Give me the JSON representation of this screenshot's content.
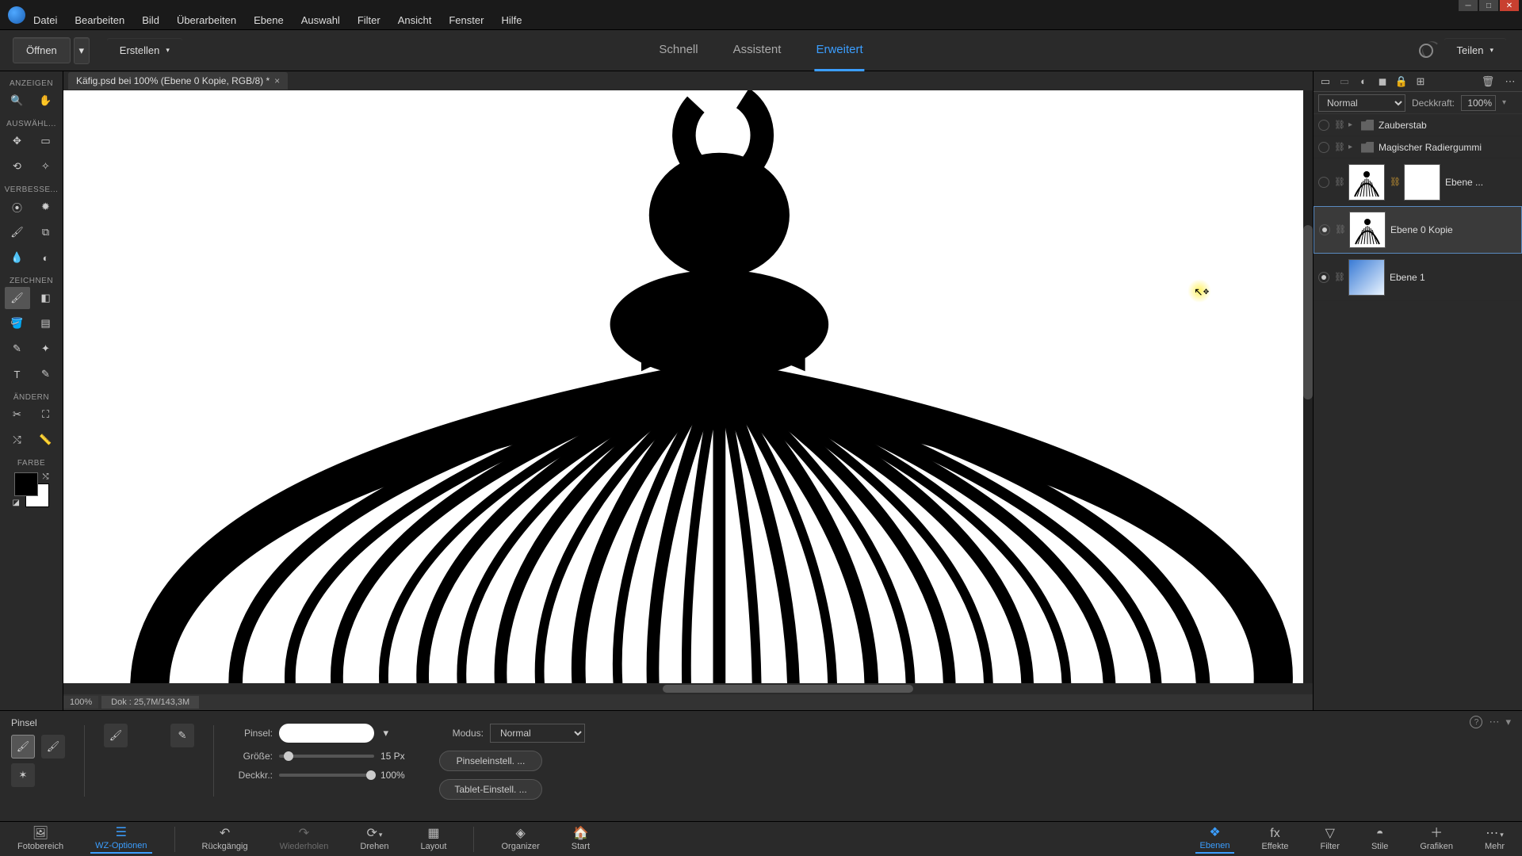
{
  "menus": [
    "Datei",
    "Bearbeiten",
    "Bild",
    "Überarbeiten",
    "Ebene",
    "Auswahl",
    "Filter",
    "Ansicht",
    "Fenster",
    "Hilfe"
  ],
  "actions": {
    "open": "Öffnen",
    "create": "Erstellen",
    "share": "Teilen"
  },
  "modes": {
    "quick": "Schnell",
    "assist": "Assistent",
    "expert": "Erweitert"
  },
  "doc_tab": "Käfig.psd bei 100% (Ebene 0 Kopie, RGB/8) *",
  "status": {
    "zoom": "100%",
    "doc": "Dok : 25,7M/143,3M"
  },
  "toolbox_sections": {
    "view": "ANZEIGEN",
    "select": "AUSWÄHL...",
    "enhance": "VERBESSE...",
    "draw": "ZEICHNEN",
    "modify": "ÄNDERN",
    "color": "FARBE"
  },
  "layers_panel": {
    "blend_mode": "Normal",
    "opacity_label": "Deckkraft:",
    "opacity_value": "100%",
    "rows": [
      {
        "name": "Zauberstab"
      },
      {
        "name": "Magischer Radiergummi"
      },
      {
        "name": "Ebene ..."
      },
      {
        "name": "Ebene 0 Kopie"
      },
      {
        "name": "Ebene 1"
      }
    ]
  },
  "options": {
    "tool": "Pinsel",
    "brush_label": "Pinsel:",
    "size_label": "Größe:",
    "size_value": "15 Px",
    "opacity_label": "Deckkr.:",
    "opacity_value": "100%",
    "mode_label": "Modus:",
    "mode_value": "Normal",
    "brush_settings": "Pinseleinstell. ...",
    "tablet_settings": "Tablet-Einstell. ..."
  },
  "bottom": {
    "fotobereich": "Fotobereich",
    "wz": "WZ-Optionen",
    "undo": "Rückgängig",
    "redo": "Wiederholen",
    "rotate": "Drehen",
    "layout": "Layout",
    "organizer": "Organizer",
    "start": "Start",
    "ebenen": "Ebenen",
    "effekte": "Effekte",
    "filter": "Filter",
    "stile": "Stile",
    "grafiken": "Grafiken",
    "mehr": "Mehr"
  }
}
